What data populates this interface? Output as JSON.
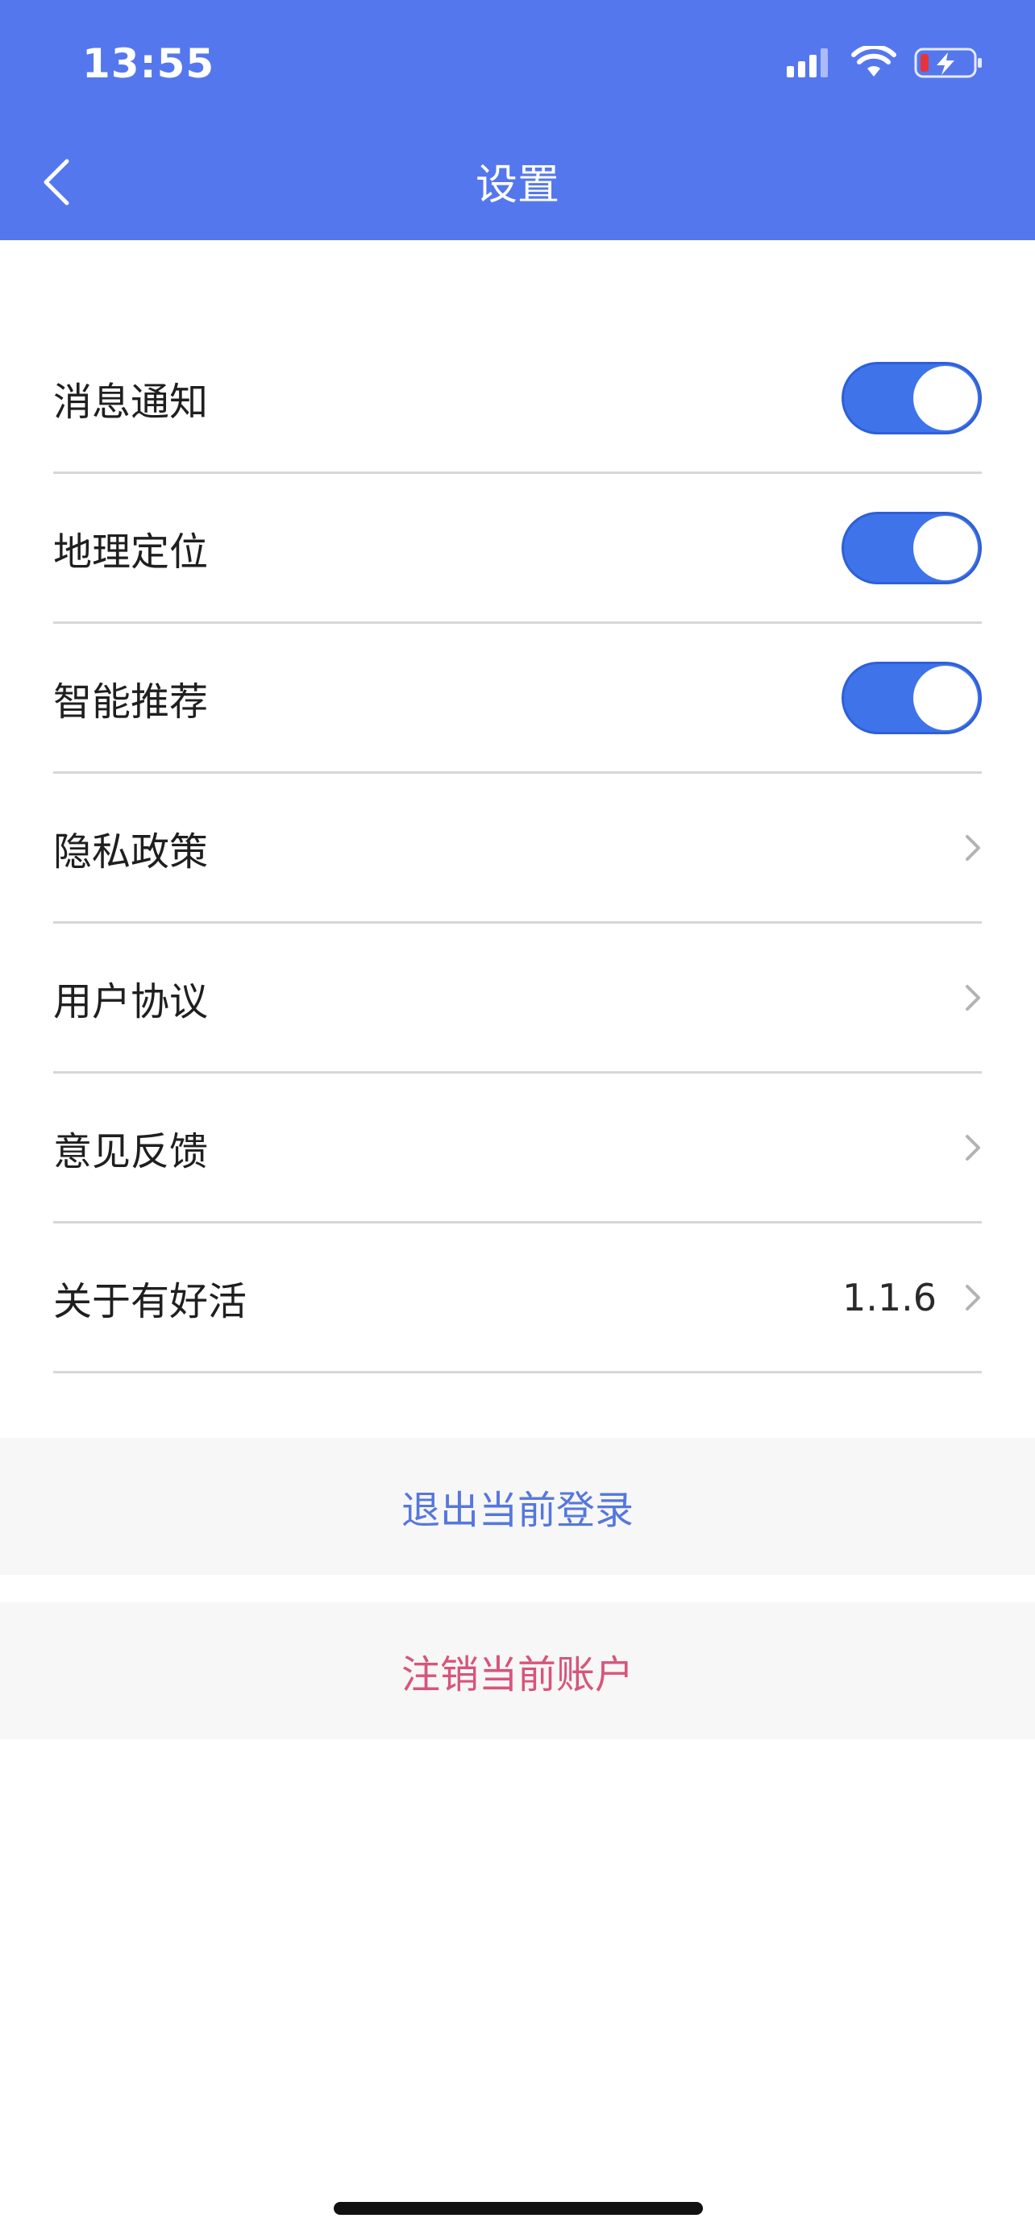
{
  "status_bar": {
    "time": "13:55"
  },
  "nav": {
    "title": "设置"
  },
  "settings": {
    "toggles": [
      {
        "label": "消息通知",
        "on": true
      },
      {
        "label": "地理定位",
        "on": true
      },
      {
        "label": "智能推荐",
        "on": true
      }
    ],
    "links": [
      {
        "label": "隐私政策"
      },
      {
        "label": "用户协议"
      },
      {
        "label": "意见反馈"
      },
      {
        "label": "关于有好活",
        "value": "1.1.6"
      }
    ]
  },
  "actions": {
    "logout_label": "退出当前登录",
    "cancel_account_label": "注销当前账户"
  },
  "icons": {
    "back": "chevron-left-icon",
    "chevron": "chevron-right-icon",
    "signal": "signal-icon",
    "wifi": "wifi-icon",
    "battery": "battery-charging-icon"
  },
  "colors": {
    "header": "#5577ee",
    "toggle": "#3f73ea",
    "logout": "#5577dd",
    "danger": "#d7557a",
    "battery_low": "#e5353a"
  }
}
